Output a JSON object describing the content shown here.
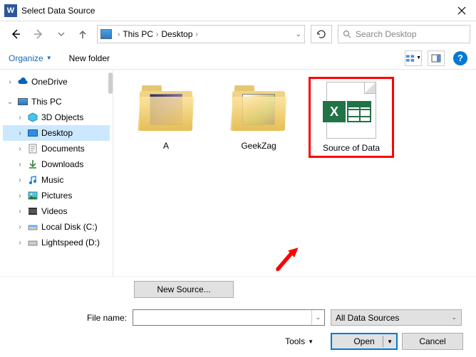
{
  "title": "Select Data Source",
  "word_badge": "W",
  "breadcrumb": {
    "root": "This PC",
    "folder": "Desktop"
  },
  "search": {
    "placeholder": "Search Desktop"
  },
  "toolbar": {
    "organize": "Organize",
    "new_folder": "New folder"
  },
  "sidebar": {
    "onedrive": "OneDrive",
    "thispc": "This PC",
    "items": [
      {
        "label": "3D Objects"
      },
      {
        "label": "Desktop"
      },
      {
        "label": "Documents"
      },
      {
        "label": "Downloads"
      },
      {
        "label": "Music"
      },
      {
        "label": "Pictures"
      },
      {
        "label": "Videos"
      },
      {
        "label": "Local Disk (C:)"
      },
      {
        "label": "Lightspeed (D:)"
      }
    ]
  },
  "files": {
    "a": "A",
    "geekzag": "GeekZag",
    "source": "Source of Data"
  },
  "bottom": {
    "new_source": "New Source...",
    "filename_label": "File name:",
    "filter": "All Data Sources",
    "tools": "Tools",
    "open": "Open",
    "cancel": "Cancel"
  }
}
